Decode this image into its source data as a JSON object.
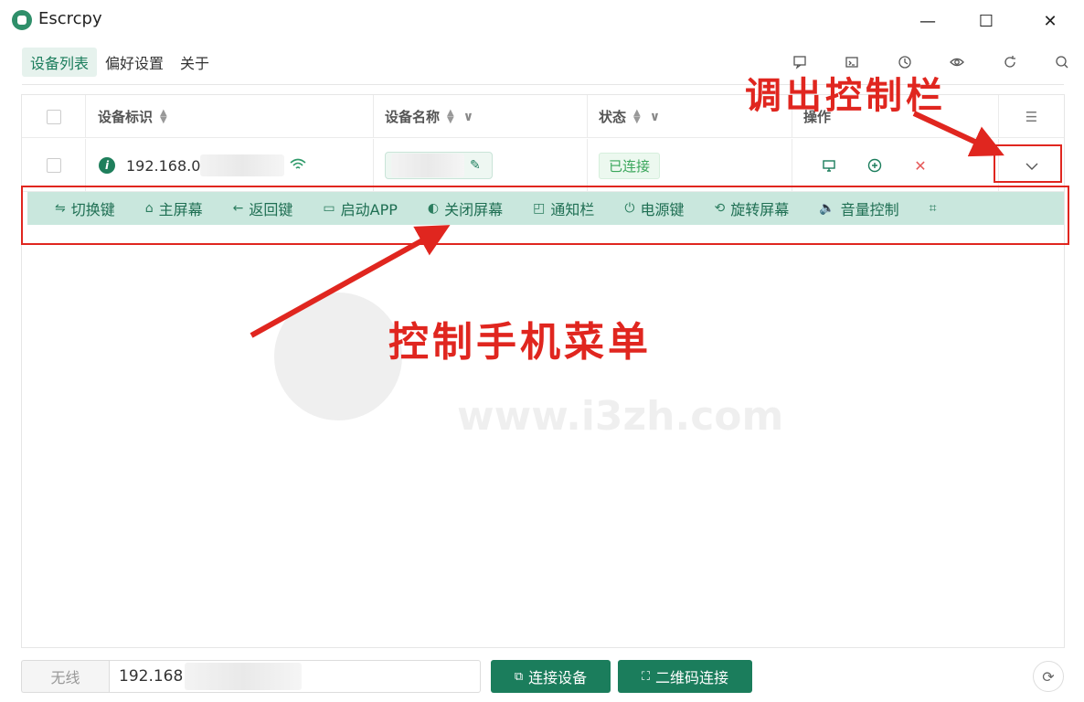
{
  "window": {
    "title": "Escrcpy",
    "minimize": "—",
    "maximize": "☐",
    "close": "✕"
  },
  "nav": {
    "tabs": [
      {
        "label": "设备列表"
      },
      {
        "label": "偏好设置"
      },
      {
        "label": "关于"
      }
    ],
    "active_tab": 0
  },
  "toolbar": {
    "icons": [
      "chat-icon",
      "terminal-icon",
      "history-icon",
      "eye-icon",
      "refresh-icon",
      "search-icon"
    ]
  },
  "table": {
    "columns": {
      "device_id": "设备标识",
      "device_name": "设备名称",
      "status": "状态",
      "actions": "操作"
    },
    "rows": [
      {
        "device_id": "192.168.0",
        "status": "已连接"
      }
    ]
  },
  "control_bar": {
    "buttons": [
      {
        "label": "切换键",
        "icon": "⇋"
      },
      {
        "label": "主屏幕",
        "icon": "⌂"
      },
      {
        "label": "返回键",
        "icon": "←"
      },
      {
        "label": "启动APP",
        "icon": "▭"
      },
      {
        "label": "关闭屏幕",
        "icon": "◐"
      },
      {
        "label": "通知栏",
        "icon": "◰"
      },
      {
        "label": "电源键",
        "icon": "⏻"
      },
      {
        "label": "旋转屏幕",
        "icon": "⟲"
      },
      {
        "label": "音量控制",
        "icon": "🔈"
      }
    ]
  },
  "annotations": {
    "expand_label": "调出控制栏",
    "menu_label": "控制手机菜单"
  },
  "watermark": {
    "text": "www.i3zh.com"
  },
  "bottom": {
    "mode": "无线",
    "address": "192.168",
    "connect_label": "连接设备",
    "qrcode_label": "二维码连接"
  },
  "colors": {
    "accent": "#1b7d5c",
    "annotation": "#e0261f",
    "control_bar": "#c9e7dd"
  }
}
